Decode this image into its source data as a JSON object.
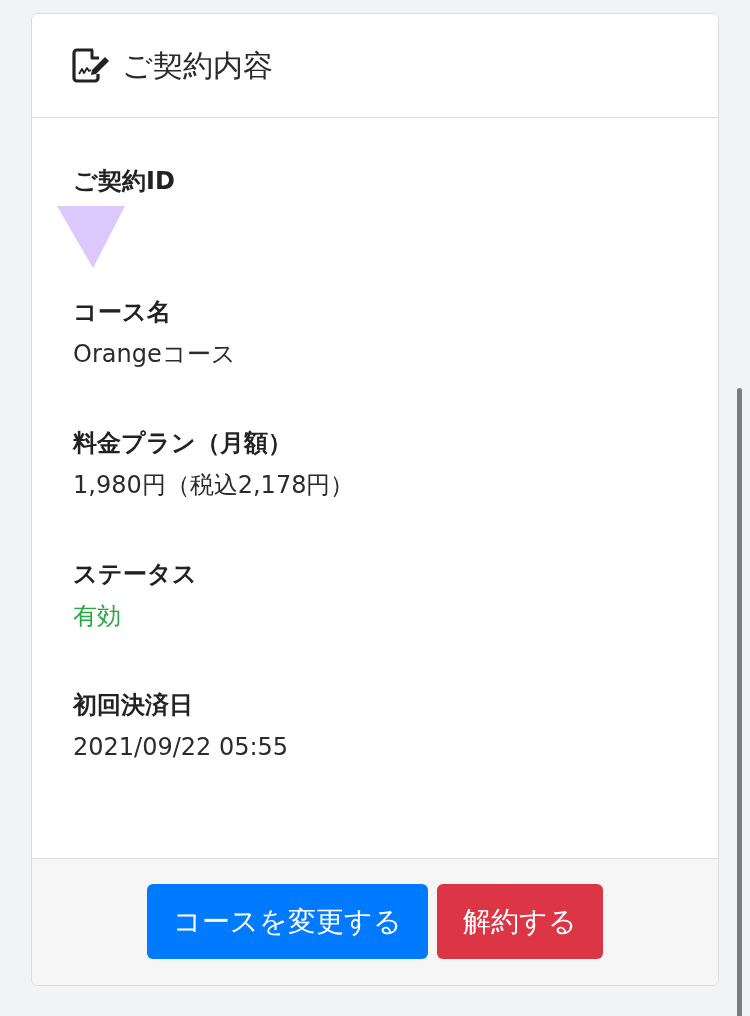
{
  "card": {
    "title": "ご契約内容"
  },
  "fields": [
    {
      "label": "ご契約ID",
      "kind": "redacted"
    },
    {
      "label": "コース名",
      "value": "Orangeコース",
      "kind": "text"
    },
    {
      "label": "料金プラン（月額）",
      "value": "1,980円（税込2,178円）",
      "kind": "text"
    },
    {
      "label": "ステータス",
      "value": "有効",
      "kind": "status"
    },
    {
      "label": "初回決済日",
      "value": "2021/09/22 05:55",
      "kind": "text"
    }
  ],
  "buttons": [
    {
      "label": "コースを変更する",
      "kind": "primary"
    },
    {
      "label": "解約する",
      "kind": "danger"
    }
  ]
}
